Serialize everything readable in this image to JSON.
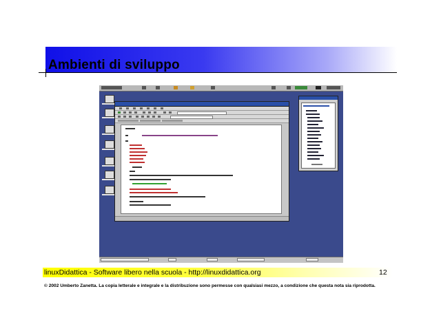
{
  "slide": {
    "title": "Ambienti di sviluppo",
    "footer": "linuxDidattica - Software libero nella scuola - http://linuxdidattica.org",
    "page_number": "12",
    "copyright": "© 2002 Umberto Zanetta. La copia letterale e integrale e la distribuzione sono permesse con qualsiasi mezzo, a condizione che questa nota sia riprodotta."
  },
  "colors": {
    "title_band": "#1010e8",
    "footer_band": "#ffff00",
    "desktop_bg": "#3a4a8c"
  }
}
